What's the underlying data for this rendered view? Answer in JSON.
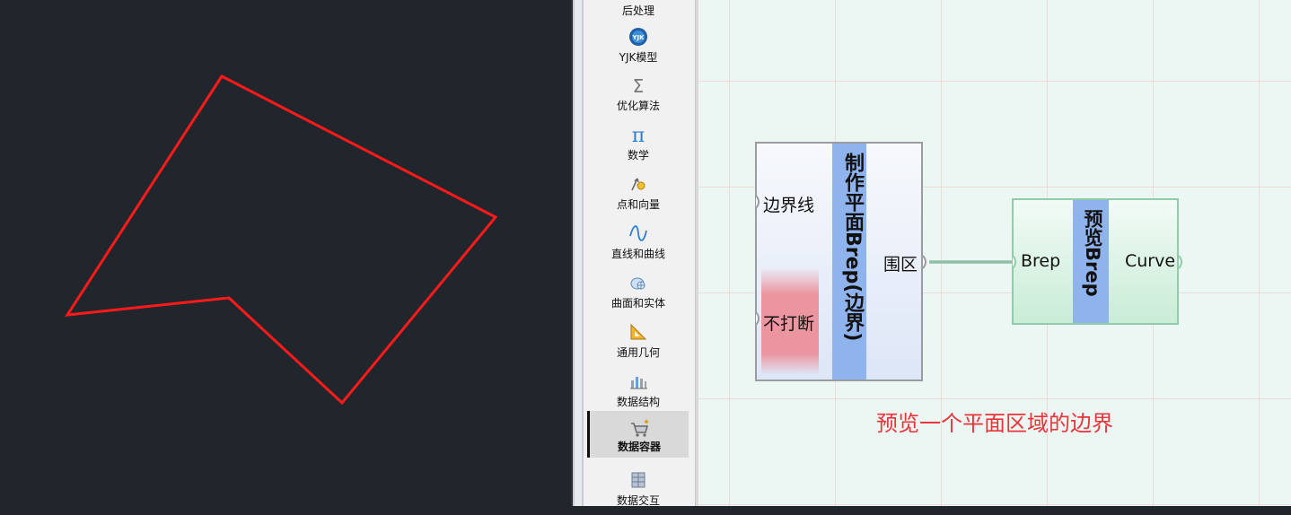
{
  "colors": {
    "viewport_bg": "#21252c",
    "polygon_stroke": "#ff1a1a",
    "canvas_bg": "#ecf6f2",
    "component_bar": "#8fb3ec",
    "caption_color": "#e8343a",
    "wire_color": "#8fbfa8"
  },
  "sidebar": {
    "items": [
      {
        "label": "后处理",
        "icon": "post-processing-icon"
      },
      {
        "label": "YJK模型",
        "icon": "yjk-model-icon"
      },
      {
        "label": "优化算法",
        "icon": "sigma-icon"
      },
      {
        "label": "数学",
        "icon": "pi-icon"
      },
      {
        "label": "点和向量",
        "icon": "point-vector-icon"
      },
      {
        "label": "直线和曲线",
        "icon": "curve-icon"
      },
      {
        "label": "曲面和实体",
        "icon": "surface-icon"
      },
      {
        "label": "通用几何",
        "icon": "triangle-ruler-icon"
      },
      {
        "label": "数据结构",
        "icon": "data-structure-icon"
      },
      {
        "label": "数据容器",
        "icon": "data-container-icon",
        "active": true
      },
      {
        "label": "数据交互",
        "icon": "data-exchange-icon"
      }
    ]
  },
  "canvas": {
    "component1": {
      "title": "制作平面Brep(边界)",
      "inputs": [
        "边界线",
        "不打断"
      ],
      "output": "围区"
    },
    "component2": {
      "title": "预览Brep",
      "input": "Brep",
      "output": "Curve"
    },
    "caption": "预览一个平面区域的边界"
  }
}
